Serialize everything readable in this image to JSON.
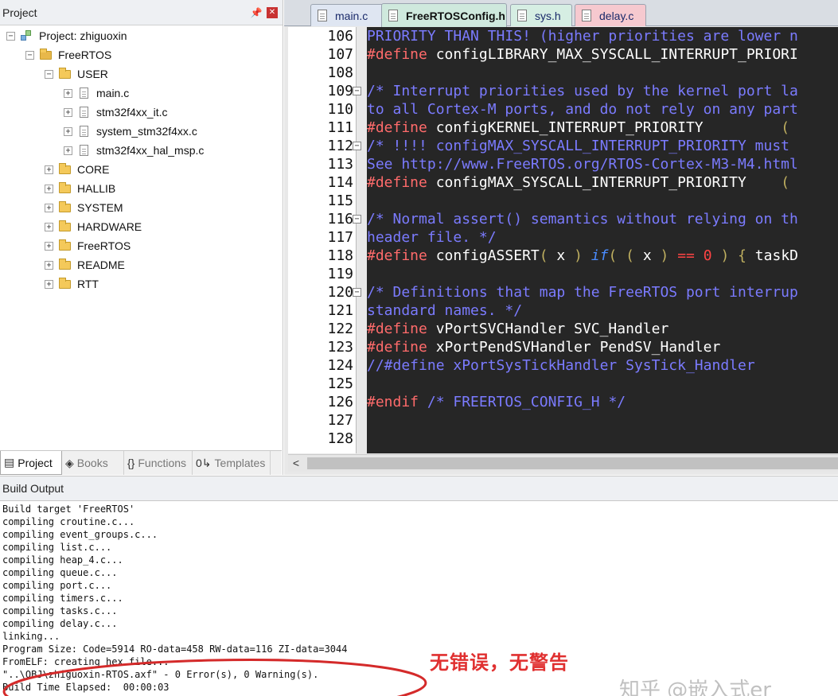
{
  "project_panel": {
    "title": "Project",
    "pin_icon": "pin-icon",
    "close_icon": "close-icon",
    "tree": [
      {
        "label": "Project: zhiguoxin",
        "kind": "project",
        "expander": "−"
      },
      {
        "label": "FreeRTOS",
        "kind": "target",
        "expander": "−"
      },
      {
        "label": "USER",
        "kind": "folder",
        "expander": "−"
      },
      {
        "label": "main.c",
        "kind": "file",
        "expander": "+"
      },
      {
        "label": "stm32f4xx_it.c",
        "kind": "file",
        "expander": "+"
      },
      {
        "label": "system_stm32f4xx.c",
        "kind": "file",
        "expander": "+"
      },
      {
        "label": "stm32f4xx_hal_msp.c",
        "kind": "file",
        "expander": "+"
      },
      {
        "label": "CORE",
        "kind": "folder",
        "expander": "+"
      },
      {
        "label": "HALLIB",
        "kind": "folder",
        "expander": "+"
      },
      {
        "label": "SYSTEM",
        "kind": "folder",
        "expander": "+"
      },
      {
        "label": "HARDWARE",
        "kind": "folder",
        "expander": "+"
      },
      {
        "label": "FreeRTOS",
        "kind": "folder",
        "expander": "+"
      },
      {
        "label": "README",
        "kind": "folder",
        "expander": "+"
      },
      {
        "label": "RTT",
        "kind": "folder",
        "expander": "+"
      }
    ],
    "bottom_tabs": [
      {
        "label": "Project",
        "icon": "project-icon",
        "glyph": "▤",
        "active": true
      },
      {
        "label": "Books",
        "icon": "books-icon",
        "glyph": "◈",
        "active": false
      },
      {
        "label": "Functions",
        "icon": "functions-icon",
        "glyph": "{}",
        "active": false
      },
      {
        "label": "Templates",
        "icon": "templates-icon",
        "glyph": "0↳",
        "active": false
      }
    ]
  },
  "editor": {
    "tabs": [
      {
        "label": "main.c",
        "active": false,
        "color": "#dfe6f2"
      },
      {
        "label": "FreeRTOSConfig.h",
        "active": true,
        "color": "#cfe9dd"
      },
      {
        "label": "sys.h",
        "active": false,
        "color": "#d6eee3"
      },
      {
        "label": "delay.c",
        "active": false,
        "color": "#f6c9cf"
      }
    ],
    "lines": [
      {
        "num": "106",
        "fold": "",
        "code": [
          [
            "c-com",
            "PRIORITY THAN THIS! (higher priorities are lower n"
          ]
        ]
      },
      {
        "num": "107",
        "fold": "",
        "code": [
          [
            "c-pre",
            "#define"
          ],
          [
            "c-txt",
            " configLIBRARY_MAX_SYSCALL_INTERRUPT_PRIORI"
          ]
        ]
      },
      {
        "num": "108",
        "fold": "",
        "code": []
      },
      {
        "num": "109",
        "fold": "−",
        "code": [
          [
            "c-com",
            "/* Interrupt priorities used by the kernel port la"
          ]
        ]
      },
      {
        "num": "110",
        "fold": "",
        "code": [
          [
            "c-com",
            "to all Cortex-M ports, and do not rely on any part"
          ]
        ]
      },
      {
        "num": "111",
        "fold": "",
        "code": [
          [
            "c-pre",
            "#define"
          ],
          [
            "c-txt",
            " configKERNEL_INTERRUPT_PRIORITY         "
          ],
          [
            "c-par",
            "("
          ]
        ]
      },
      {
        "num": "112",
        "fold": "−",
        "code": [
          [
            "c-com",
            "/* !!!! configMAX_SYSCALL_INTERRUPT_PRIORITY must"
          ]
        ]
      },
      {
        "num": "113",
        "fold": "",
        "code": [
          [
            "c-com",
            "See http://www.FreeRTOS.org/RTOS-Cortex-M3-M4.html"
          ]
        ]
      },
      {
        "num": "114",
        "fold": "",
        "code": [
          [
            "c-pre",
            "#define"
          ],
          [
            "c-txt",
            " configMAX_SYSCALL_INTERRUPT_PRIORITY    "
          ],
          [
            "c-par",
            "("
          ]
        ]
      },
      {
        "num": "115",
        "fold": "",
        "code": []
      },
      {
        "num": "116",
        "fold": "−",
        "code": [
          [
            "c-com",
            "/* Normal assert() semantics without relying on th"
          ]
        ]
      },
      {
        "num": "117",
        "fold": "",
        "code": [
          [
            "c-com",
            "header file. */"
          ]
        ]
      },
      {
        "num": "118",
        "fold": "",
        "code": [
          [
            "c-pre",
            "#define"
          ],
          [
            "c-txt",
            " configASSERT"
          ],
          [
            "c-par",
            "("
          ],
          [
            "c-txt",
            " x "
          ],
          [
            "c-par",
            ")"
          ],
          [
            "c-txt",
            " "
          ],
          [
            "c-kw",
            "if"
          ],
          [
            "c-par",
            "("
          ],
          [
            "c-txt",
            " "
          ],
          [
            "c-par",
            "("
          ],
          [
            "c-txt",
            " x "
          ],
          [
            "c-par",
            ")"
          ],
          [
            "c-txt",
            " "
          ],
          [
            "c-op",
            "=="
          ],
          [
            "c-txt",
            " "
          ],
          [
            "c-num",
            "0"
          ],
          [
            "c-txt",
            " "
          ],
          [
            "c-par",
            ")"
          ],
          [
            "c-txt",
            " "
          ],
          [
            "c-par",
            "{"
          ],
          [
            "c-txt",
            " taskD"
          ]
        ]
      },
      {
        "num": "119",
        "fold": "",
        "code": []
      },
      {
        "num": "120",
        "fold": "−",
        "code": [
          [
            "c-com",
            "/* Definitions that map the FreeRTOS port interrup"
          ]
        ]
      },
      {
        "num": "121",
        "fold": "",
        "code": [
          [
            "c-com",
            "standard names. */"
          ]
        ]
      },
      {
        "num": "122",
        "fold": "",
        "code": [
          [
            "c-pre",
            "#define"
          ],
          [
            "c-txt",
            " vPortSVCHandler SVC_Handler"
          ]
        ]
      },
      {
        "num": "123",
        "fold": "",
        "code": [
          [
            "c-pre",
            "#define"
          ],
          [
            "c-txt",
            " xPortPendSVHandler PendSV_Handler"
          ]
        ]
      },
      {
        "num": "124",
        "fold": "",
        "code": [
          [
            "c-com",
            "//#define xPortSysTickHandler SysTick_Handler"
          ]
        ]
      },
      {
        "num": "125",
        "fold": "",
        "code": []
      },
      {
        "num": "126",
        "fold": "",
        "code": [
          [
            "c-pre",
            "#endif"
          ],
          [
            "c-com",
            " /* FREERTOS_CONFIG_H */"
          ]
        ]
      },
      {
        "num": "127",
        "fold": "",
        "code": []
      },
      {
        "num": "128",
        "fold": "",
        "code": []
      }
    ],
    "scroll_left_icon": "scroll-left-icon"
  },
  "build_output": {
    "title": "Build Output",
    "lines": [
      "Build target 'FreeRTOS'",
      "compiling croutine.c...",
      "compiling event_groups.c...",
      "compiling list.c...",
      "compiling heap_4.c...",
      "compiling queue.c...",
      "compiling port.c...",
      "compiling timers.c...",
      "compiling tasks.c...",
      "compiling delay.c...",
      "linking...",
      "Program Size: Code=5914 RO-data=458 RW-data=116 ZI-data=3044",
      "FromELF: creating hex file...",
      "\"..\\OBJ\\zhiguoxin-RTOS.axf\" - 0 Error(s), 0 Warning(s).",
      "Build Time Elapsed:  00:00:03"
    ],
    "annotation": "无错误，无警告",
    "watermark": "知乎 @嵌入式er",
    "highlight_color": "#e03030"
  }
}
